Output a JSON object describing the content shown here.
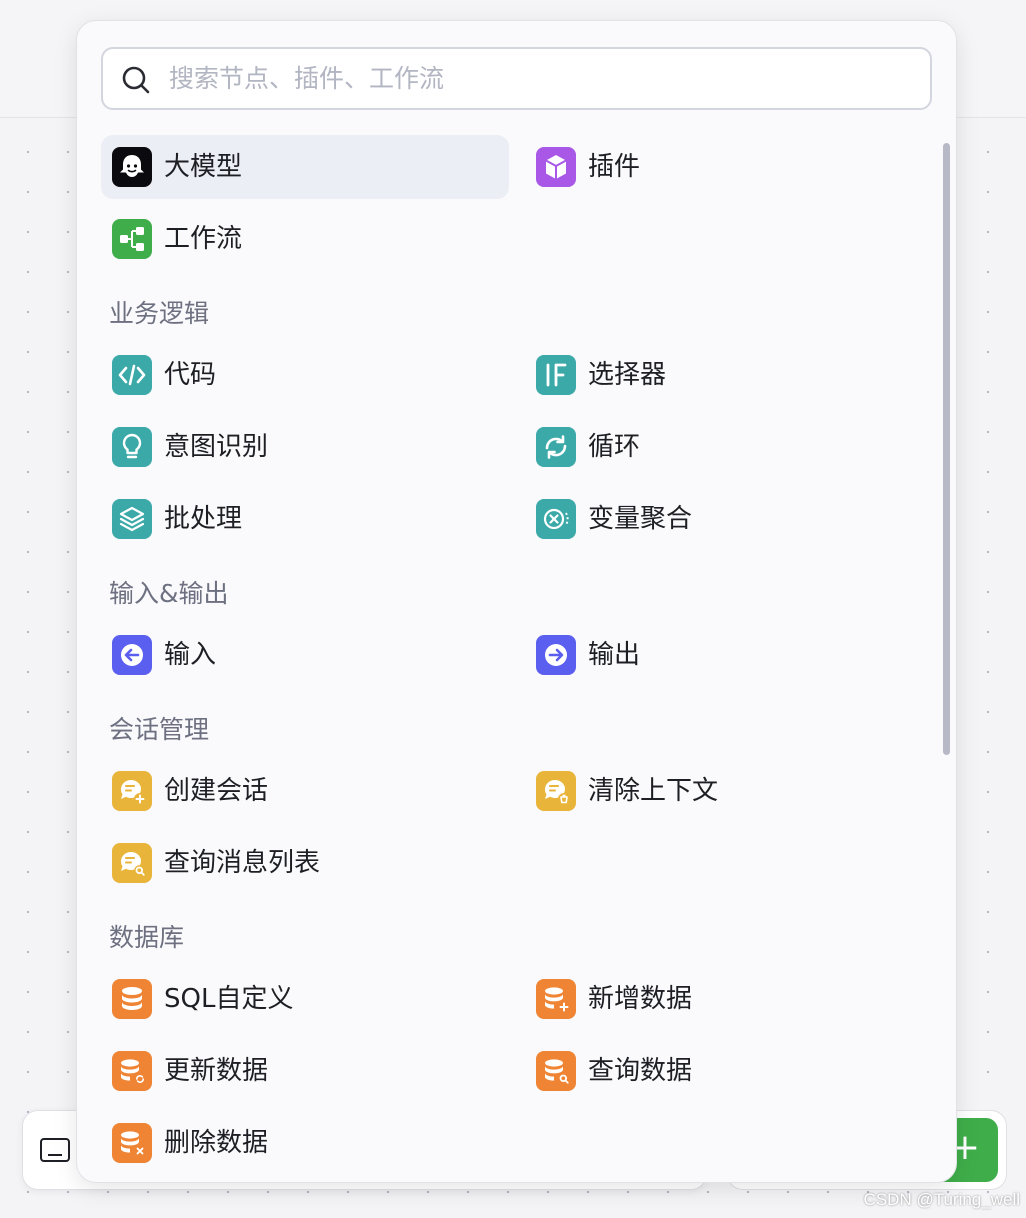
{
  "search": {
    "placeholder": "搜索节点、插件、工作流"
  },
  "top_items": [
    {
      "label": "大模型",
      "icon": "llm-icon",
      "color": "#0b0b0f"
    },
    {
      "label": "插件",
      "icon": "plugin-cube-icon",
      "color": "#a857e6"
    },
    {
      "label": "工作流",
      "icon": "workflow-icon",
      "color": "#3fae4a"
    }
  ],
  "sections": [
    {
      "title": "业务逻辑",
      "color": "#3ba9a8",
      "items": [
        {
          "label": "代码",
          "icon": "code-icon"
        },
        {
          "label": "选择器",
          "icon": "if-selector-icon"
        },
        {
          "label": "意图识别",
          "icon": "intent-bulb-icon"
        },
        {
          "label": "循环",
          "icon": "loop-icon"
        },
        {
          "label": "批处理",
          "icon": "batch-layers-icon"
        },
        {
          "label": "变量聚合",
          "icon": "variable-aggregate-icon"
        }
      ]
    },
    {
      "title": "输入&输出",
      "color": "#5b5ff0",
      "items": [
        {
          "label": "输入",
          "icon": "input-arrow-icon"
        },
        {
          "label": "输出",
          "icon": "output-arrow-icon"
        }
      ]
    },
    {
      "title": "会话管理",
      "color": "#e9b43a",
      "items": [
        {
          "label": "创建会话",
          "icon": "create-conversation-icon"
        },
        {
          "label": "清除上下文",
          "icon": "clear-context-icon"
        },
        {
          "label": "查询消息列表",
          "icon": "query-messages-icon"
        }
      ]
    },
    {
      "title": "数据库",
      "color": "#ee8434",
      "items": [
        {
          "label": "SQL自定义",
          "icon": "sql-database-icon"
        },
        {
          "label": "新增数据",
          "icon": "add-data-icon"
        },
        {
          "label": "更新数据",
          "icon": "update-data-icon"
        },
        {
          "label": "查询数据",
          "icon": "query-data-icon"
        },
        {
          "label": "删除数据",
          "icon": "delete-data-icon"
        }
      ]
    }
  ],
  "watermark": "CSDN @Turing_well"
}
